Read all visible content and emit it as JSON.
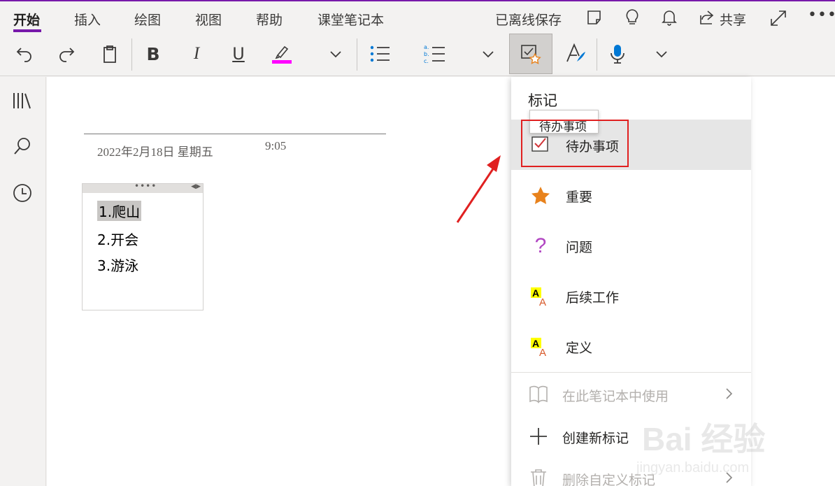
{
  "tabs": [
    {
      "label": "开始",
      "active": true
    },
    {
      "label": "插入",
      "active": false
    },
    {
      "label": "绘图",
      "active": false
    },
    {
      "label": "视图",
      "active": false
    },
    {
      "label": "帮助",
      "active": false
    },
    {
      "label": "课堂笔记本",
      "active": false
    }
  ],
  "header": {
    "offline_status": "已离线保存",
    "share_label": "共享"
  },
  "toolbar": {
    "highlight_color": "#ff00ff",
    "accent_color": "#7719aa"
  },
  "page": {
    "date": "2022年2月18日 星期五",
    "time": "9:05"
  },
  "note": {
    "items": [
      "1.爬山",
      "2.开会",
      "3.游泳"
    ]
  },
  "tags_menu": {
    "title": "标记",
    "tooltip": "待办事项",
    "items": [
      {
        "label": "待办事项",
        "icon": "checkbox-icon"
      },
      {
        "label": "重要",
        "icon": "star-icon"
      },
      {
        "label": "问题",
        "icon": "question-icon"
      },
      {
        "label": "后续工作",
        "icon": "highlight-a-icon"
      },
      {
        "label": "定义",
        "icon": "highlight-a-icon"
      }
    ],
    "use_in_notebook": "在此笔记本中使用",
    "create_tag": "创建新标记",
    "delete_custom": "删除自定义标记"
  },
  "watermark": {
    "brand": "Bai 经验",
    "url": "jingyan.baidu.com"
  }
}
